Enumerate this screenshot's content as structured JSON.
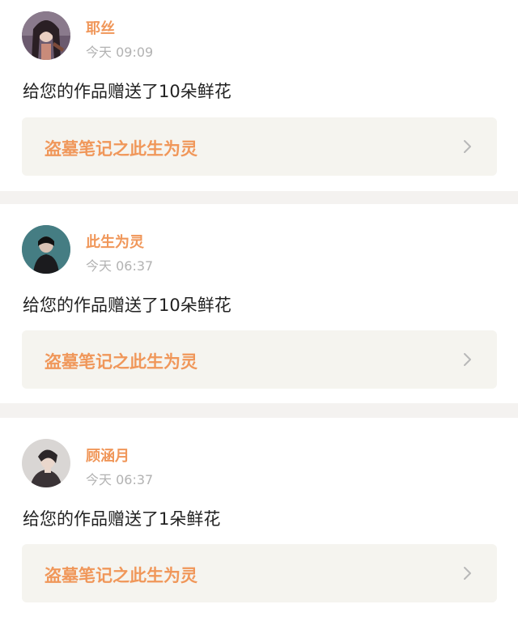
{
  "notifications": [
    {
      "user": "耶丝",
      "time": "今天 09:09",
      "message": "给您的作品赠送了10朵鲜花",
      "work_title": "盗墓笔记之此生为灵",
      "avatar_icon": "avatar-girl-dark-hair",
      "chevron_icon": "chevron-right-icon"
    },
    {
      "user": "此生为灵",
      "time": "今天 06:37",
      "message": "给您的作品赠送了10朵鲜花",
      "work_title": "盗墓笔记之此生为灵",
      "avatar_icon": "avatar-figure-dark",
      "chevron_icon": "chevron-right-icon"
    },
    {
      "user": "顾涵月",
      "time": "今天 06:37",
      "message": "给您的作品赠送了1朵鲜花",
      "work_title": "盗墓笔记之此生为灵",
      "avatar_icon": "avatar-person-portrait",
      "chevron_icon": "chevron-right-icon"
    }
  ],
  "colors": {
    "accent": "#f0975a",
    "time_text": "#b2b2b2",
    "message_text": "#222222",
    "link_bg": "#f5f4ef",
    "page_bg": "#f4f2f0"
  }
}
